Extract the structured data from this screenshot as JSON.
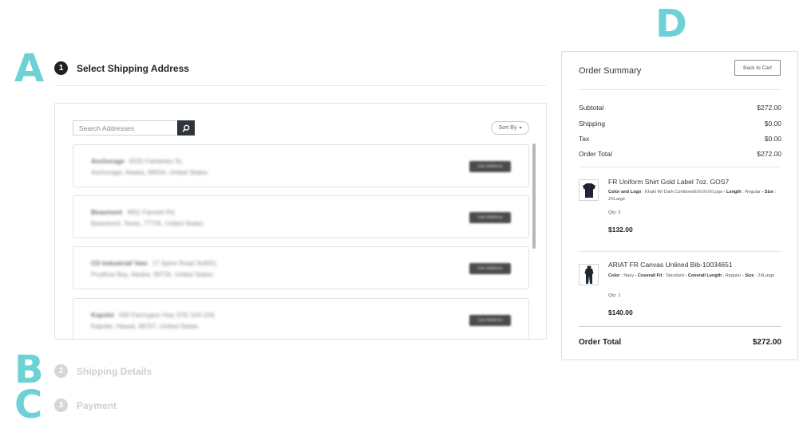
{
  "annotations": {
    "a": "A",
    "b": "B",
    "c": "C",
    "d": "D"
  },
  "steps": [
    {
      "number": "1",
      "label": "Select Shipping Address",
      "state": "active"
    },
    {
      "number": "2",
      "label": "Shipping Details",
      "state": "inactive"
    },
    {
      "number": "3",
      "label": "Payment",
      "state": "inactive"
    }
  ],
  "address_panel": {
    "search_placeholder": "Search Addresses",
    "search_icon": "search-icon",
    "sort_label": "Sort By",
    "addresses": [
      {
        "name": "Anchorage",
        "line1": "5020 Fairbanks St,",
        "line2": "Anchorage, Alaska, 99504, United States",
        "button": "Use Address"
      },
      {
        "name": "Beaumont",
        "line1": "4811 Fannett Rd,",
        "line2": "Beaumont, Texas, 77705, United States",
        "button": "Use Address"
      },
      {
        "name": "CD Industrial/ Vam",
        "line1": "17 Spine Road 3rd001,",
        "line2": "Prudhoe Bay, Alaska, 99734, United States",
        "button": "Use Address"
      },
      {
        "name": "Kapolei",
        "line1": "590 Farrington Hwy STE 524-228,",
        "line2": "Kapolei, Hawaii, 96707, United States",
        "button": "Use Address"
      }
    ]
  },
  "summary": {
    "title": "Order Summary",
    "back_label": "Back to Cart",
    "totals": [
      {
        "label": "Subtotal",
        "value": "$272.00"
      },
      {
        "label": "Shipping",
        "value": "$0.00"
      },
      {
        "label": "Tax",
        "value": "$0.00"
      },
      {
        "label": "Order Total",
        "value": "$272.00"
      }
    ],
    "items": [
      {
        "name": "FR Uniform Shirt Gold Label 7oz. GOS7",
        "attributes": [
          {
            "k": "Color and Logo",
            "sep": " : ",
            "v": "Khaki W/ Dark Combined//////////////Logo"
          },
          {
            "k": " - Length",
            "sep": " : ",
            "v": "Regular"
          },
          {
            "k": " - Size",
            "sep": " : ",
            "v": "2XLarge"
          }
        ],
        "qty": "Qty: 2",
        "price": "$132.00",
        "thumb_icon": "shirt-icon"
      },
      {
        "name": "ARIAT FR Canvas Unlined Bib-10034651",
        "attributes": [
          {
            "k": "Color",
            "sep": " : ",
            "v": "Navy"
          },
          {
            "k": " - Coverall Fit",
            "sep": " : ",
            "v": "Standard"
          },
          {
            "k": " - Coverall Length",
            "sep": " : ",
            "v": "Regular"
          },
          {
            "k": " - Size",
            "sep": " : ",
            "v": "2XLarge"
          }
        ],
        "qty": "Qty: 1",
        "price": "$140.00",
        "thumb_icon": "coverall-icon"
      }
    ],
    "grand_total_label": "Order Total",
    "grand_total_value": "$272.00"
  },
  "colors": {
    "annotation": "#6cd2d6",
    "dark": "#2f3439",
    "inactive": "#d6d6d6"
  }
}
